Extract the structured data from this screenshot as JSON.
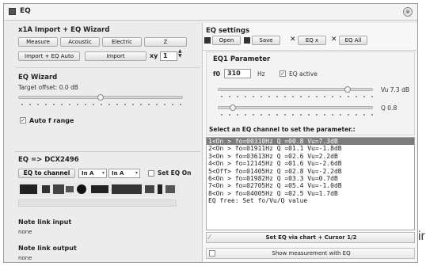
{
  "window": {
    "title": "EQ",
    "close_glyph": "⊗"
  },
  "left": {
    "import_section": {
      "title": "x1A Import + EQ Wizard",
      "buttons": [
        "Measure",
        "Acoustic",
        "Electric",
        "Z"
      ],
      "import_eq_auto": "Import + EQ Auto",
      "import": "Import",
      "xy_label": "xy",
      "xy_value": "1"
    },
    "wizard": {
      "title": "EQ Wizard",
      "target_offset": "Target offset: 0.0 dB",
      "target_offset_level": 0.5,
      "auto_f_range_label": "Auto f range",
      "auto_f_range_checked": true
    },
    "dcx": {
      "title": "EQ => DCX2496",
      "eq_to_channel": "EQ to channel",
      "in_a_1": "In A",
      "in_a_2": "In A",
      "set_eq_on": "Set EQ On",
      "set_eq_on_checked": false,
      "note_in_label": "Note link input",
      "note_in_value": "none",
      "note_out_label": "Note link output",
      "note_out_value": "none"
    }
  },
  "right": {
    "title": "EQ settings",
    "toolbar": {
      "open": "Open",
      "save": "Save",
      "eq_x": "EQ x",
      "eq_all": "EQ All"
    },
    "param": {
      "title": "EQ1 Parameter",
      "f0_label": "f0",
      "f0_value": "310",
      "hz_label": "Hz",
      "eq_active_label": "EQ active",
      "eq_active_checked": true,
      "vu_value": "Vu 7.3 dB",
      "vu_level": 0.85,
      "q_value": "Q 0.8",
      "q_level": 0.08
    },
    "select_prompt": "Select an EQ channel to set the parameter.:",
    "channels": [
      "1<On > fo=00310Hz Q =00.8 Vu=7.3dB",
      "2<On > fo=01911Hz Q =01.1 Vu=-1.8dB",
      "3<On > fo=03613Hz Q =02.6 Vu=2.2dB",
      "4<On > fo=12145Hz Q =01.6 Vu=-2.6dB",
      "5<Off> fo=01405Hz Q =02.8 Vu=-2.2dB",
      "6<On > fo=01982Hz Q =03.3 Vu=0.7dB",
      "7<On > fo=02705Hz Q =05.4 Vu=-1.0dB",
      "8<On > fo=04005Hz Q =02.5 Vu=1.7dB",
      "EQ free: Set fo/Vu/Q value"
    ],
    "selected_index": 0,
    "set_via_chart": "Set EQ via chart + Cursor 1/2",
    "show_measurement": "Show measurement with EQ"
  },
  "outside_text": "ir"
}
